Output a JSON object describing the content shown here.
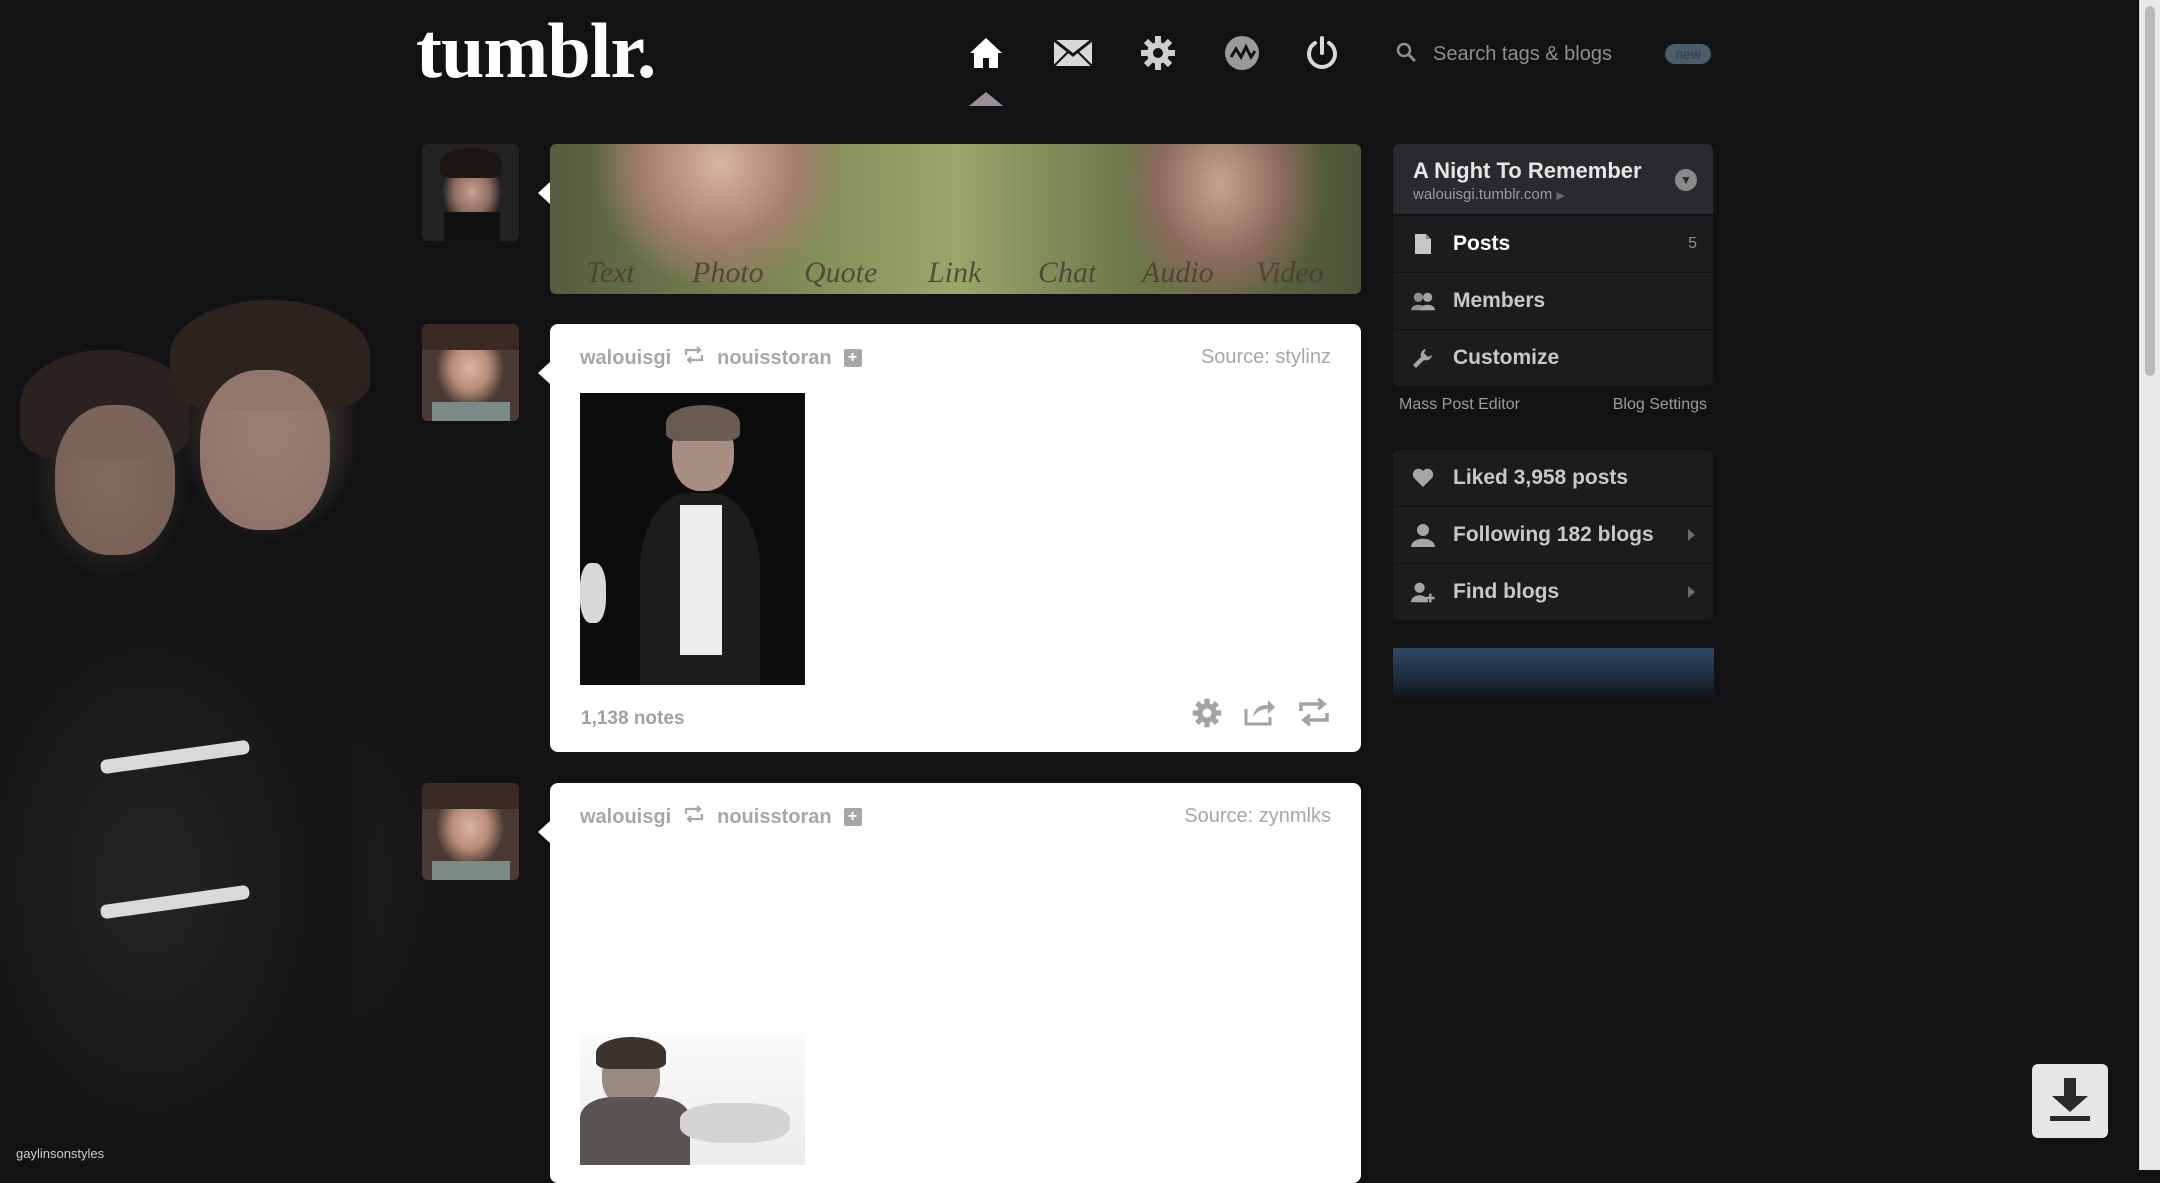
{
  "header": {
    "logo": "tumblr.",
    "nav": [
      "home-icon",
      "mail-icon",
      "gear-icon",
      "activity-icon",
      "power-icon"
    ],
    "search_placeholder": "Search tags & blogs",
    "search_badge": "new"
  },
  "compose": {
    "labels": [
      "Text",
      "Photo",
      "Quote",
      "Link",
      "Chat",
      "Audio",
      "Video"
    ]
  },
  "posts": [
    {
      "author": "walouisgi",
      "reblogged_from": "nouisstoran",
      "source": "Source: stylinz",
      "notes": "1,138 notes"
    },
    {
      "author": "walouisgi",
      "reblogged_from": "nouisstoran",
      "source": "Source: zynmlks"
    }
  ],
  "sidebar": {
    "blog_title": "A Night To Remember",
    "blog_url": "walouisgi.tumblr.com",
    "items": [
      {
        "label": "Posts",
        "count": "5"
      },
      {
        "label": "Members"
      },
      {
        "label": "Customize"
      }
    ],
    "links": {
      "mass_post_editor": "Mass Post Editor",
      "blog_settings": "Blog Settings"
    },
    "account": [
      {
        "label": "Liked 3,958 posts"
      },
      {
        "label": "Following 182 blogs"
      },
      {
        "label": "Find blogs"
      }
    ]
  },
  "watermark": "gaylinsonstyles"
}
